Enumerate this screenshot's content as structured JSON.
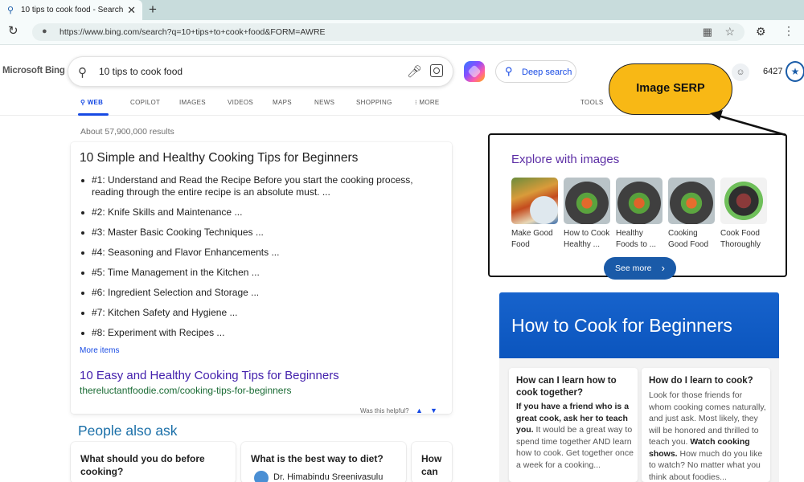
{
  "browser": {
    "tab_title": "10 tips to cook food - Search",
    "tab_close": "✕",
    "new_tab": "+",
    "url": "https://www.bing.com/search?q=10+tips+to+cook+food&FORM=AWRE"
  },
  "header": {
    "logo": "Microsoft Bing",
    "query": "10 tips to cook food",
    "deep_search": "Deep search",
    "points": "6427"
  },
  "scopes": [
    "WEB",
    "COPILOT",
    "IMAGES",
    "VIDEOS",
    "MAPS",
    "NEWS",
    "SHOPPING",
    "⁝ MORE",
    "TOOLS"
  ],
  "results": {
    "count": "About 57,900,000 results",
    "card_title": "10 Simple and Healthy Cooking Tips for Beginners",
    "tips": [
      "#1: Understand and Read the Recipe Before you start the cooking process, reading through the entire recipe is an absolute must. ...",
      "#2: Knife Skills and Maintenance ...",
      "#3: Master Basic Cooking Techniques ...",
      "#4: Seasoning and Flavor Enhancements ...",
      "#5: Time Management in the Kitchen ...",
      "#6: Ingredient Selection and Storage ...",
      "#7: Kitchen Safety and Hygiene ...",
      "#8: Experiment with Recipes ..."
    ],
    "more_items": "More items",
    "link_title": "10 Easy and Healthy Cooking Tips for Beginners",
    "link_url": "thereluctantfoodie.com/cooking-tips-for-beginners",
    "helpful": "Was this helpful?"
  },
  "paa": {
    "title": "People also ask",
    "questions": [
      {
        "q": "What should you do before cooking?",
        "author": ""
      },
      {
        "q": "What is the best way to diet?",
        "author": "Dr. Himabindu Sreenivasulu"
      },
      {
        "q": "How can skills?",
        "author": ""
      }
    ]
  },
  "explore": {
    "title": "Explore with images",
    "images": [
      {
        "caption": "Make Good Food"
      },
      {
        "caption": "How to Cook Healthy ..."
      },
      {
        "caption": "Healthy Foods to ..."
      },
      {
        "caption": "Cooking Good Food"
      },
      {
        "caption": "Cook Food Thoroughly"
      }
    ],
    "see_more": "See more",
    "see_more_chevron": "›"
  },
  "annotation": {
    "callout": "Image SERP",
    "accent": "#f8b815"
  },
  "knowledge": {
    "banner": "How to Cook for Beginners",
    "cards": [
      {
        "q": "How can I learn how to cook together?",
        "a_bold": "If you have a friend who is a great cook, ask her to teach you.",
        "a_rest": " It would be a great way to spend time together AND learn how to cook. Get together once a week for a cooking..."
      },
      {
        "q": "How do I learn to cook?",
        "a_pre": "Look for those friends for whom cooking comes naturally, and just ask. Most likely, they will be honored and thrilled to teach you. ",
        "a_bold": "Watch cooking shows.",
        "a_rest": " How much do you like to watch? No matter what you think about foodies..."
      }
    ]
  },
  "colors": {
    "bing_blue": "#174ae4",
    "link_purple": "#4421ad",
    "url_green": "#1a6b34",
    "banner_blue": "#1763cc"
  }
}
